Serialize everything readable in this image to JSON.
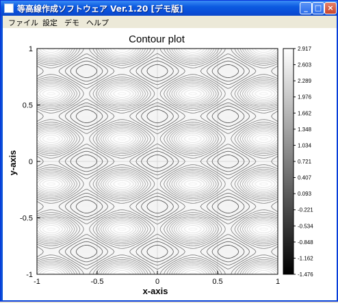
{
  "window": {
    "title": "等高線作成ソフトウェア Ver.1.20 [デモ版]",
    "controls": {
      "minimize": "_",
      "maximize": "□",
      "close": "×"
    }
  },
  "menu": {
    "items": [
      "ファイル",
      "設定",
      "デモ",
      "ヘルプ"
    ]
  },
  "chart_data": {
    "type": "contour",
    "title": "Contour plot",
    "xlabel": "x-axis",
    "ylabel": "y-axis",
    "xlim": [
      -1,
      1
    ],
    "ylim": [
      -1,
      1
    ],
    "x_ticks": [
      "-1",
      "-0.5",
      "0",
      "0.5",
      "1"
    ],
    "y_ticks": [
      "-1",
      "-0.5",
      "0",
      "0.5",
      "1"
    ],
    "grid": true,
    "colormap": "grayscale (black = low, white = high)",
    "colorbar": {
      "min": -1.476,
      "max": 2.917,
      "tick_labels": [
        "2.917",
        "2.603",
        "2.289",
        "1.976",
        "1.662",
        "1.348",
        "1.034",
        "0.721",
        "0.407",
        "0.093",
        "-0.221",
        "-0.534",
        "-0.848",
        "-1.162",
        "-1.476"
      ]
    },
    "features": {
      "minima_dark_ovals_at": [
        [
          0,
          0.8
        ],
        [
          0,
          0
        ],
        [
          0,
          -0.8
        ]
      ],
      "maxima_light_regions_at": [
        [
          -0.6,
          0.4
        ],
        [
          0.6,
          0.4
        ],
        [
          -0.6,
          -0.4
        ],
        [
          0.6,
          -0.4
        ]
      ]
    }
  }
}
